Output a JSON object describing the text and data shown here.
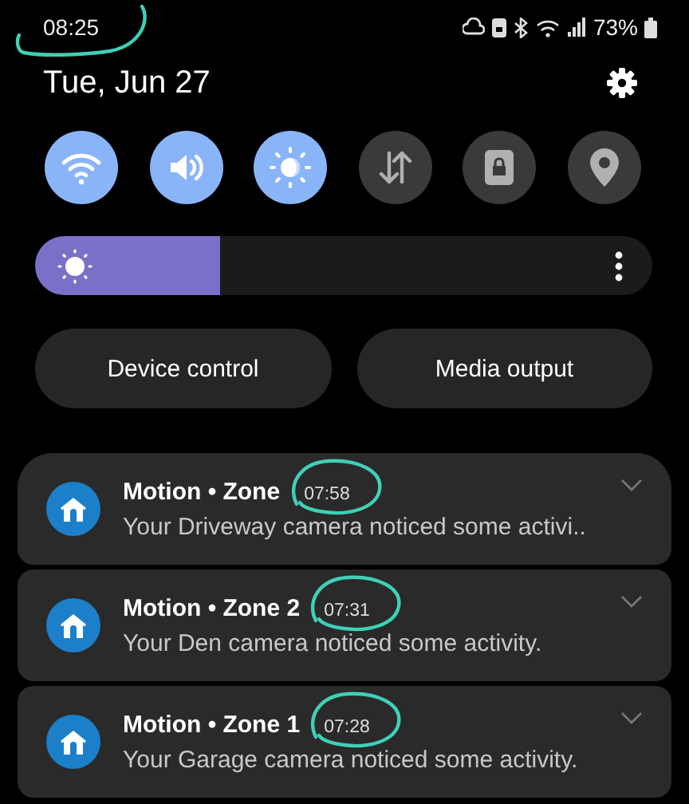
{
  "status_bar": {
    "time": "08:25",
    "battery": "73%"
  },
  "header": {
    "date": "Tue, Jun 27"
  },
  "quick_tiles": [
    {
      "kind": "wifi",
      "on": true
    },
    {
      "kind": "sound",
      "on": true
    },
    {
      "kind": "eye-comfort",
      "on": true
    },
    {
      "kind": "data",
      "on": false
    },
    {
      "kind": "secure-folder",
      "on": false
    },
    {
      "kind": "location",
      "on": false
    }
  ],
  "brightness": {
    "level": 0.3
  },
  "buttons": [
    "Device control",
    "Media output"
  ],
  "notifications": [
    {
      "title": "Motion • Zone",
      "time": "07:58",
      "text": "Your Driveway camera noticed some activi.."
    },
    {
      "title": "Motion • Zone 2",
      "time": "07:31",
      "text": "Your Den camera noticed some activity."
    },
    {
      "title": "Motion • Zone 1",
      "time": "07:28",
      "text": "Your Garage camera noticed some activity."
    }
  ]
}
